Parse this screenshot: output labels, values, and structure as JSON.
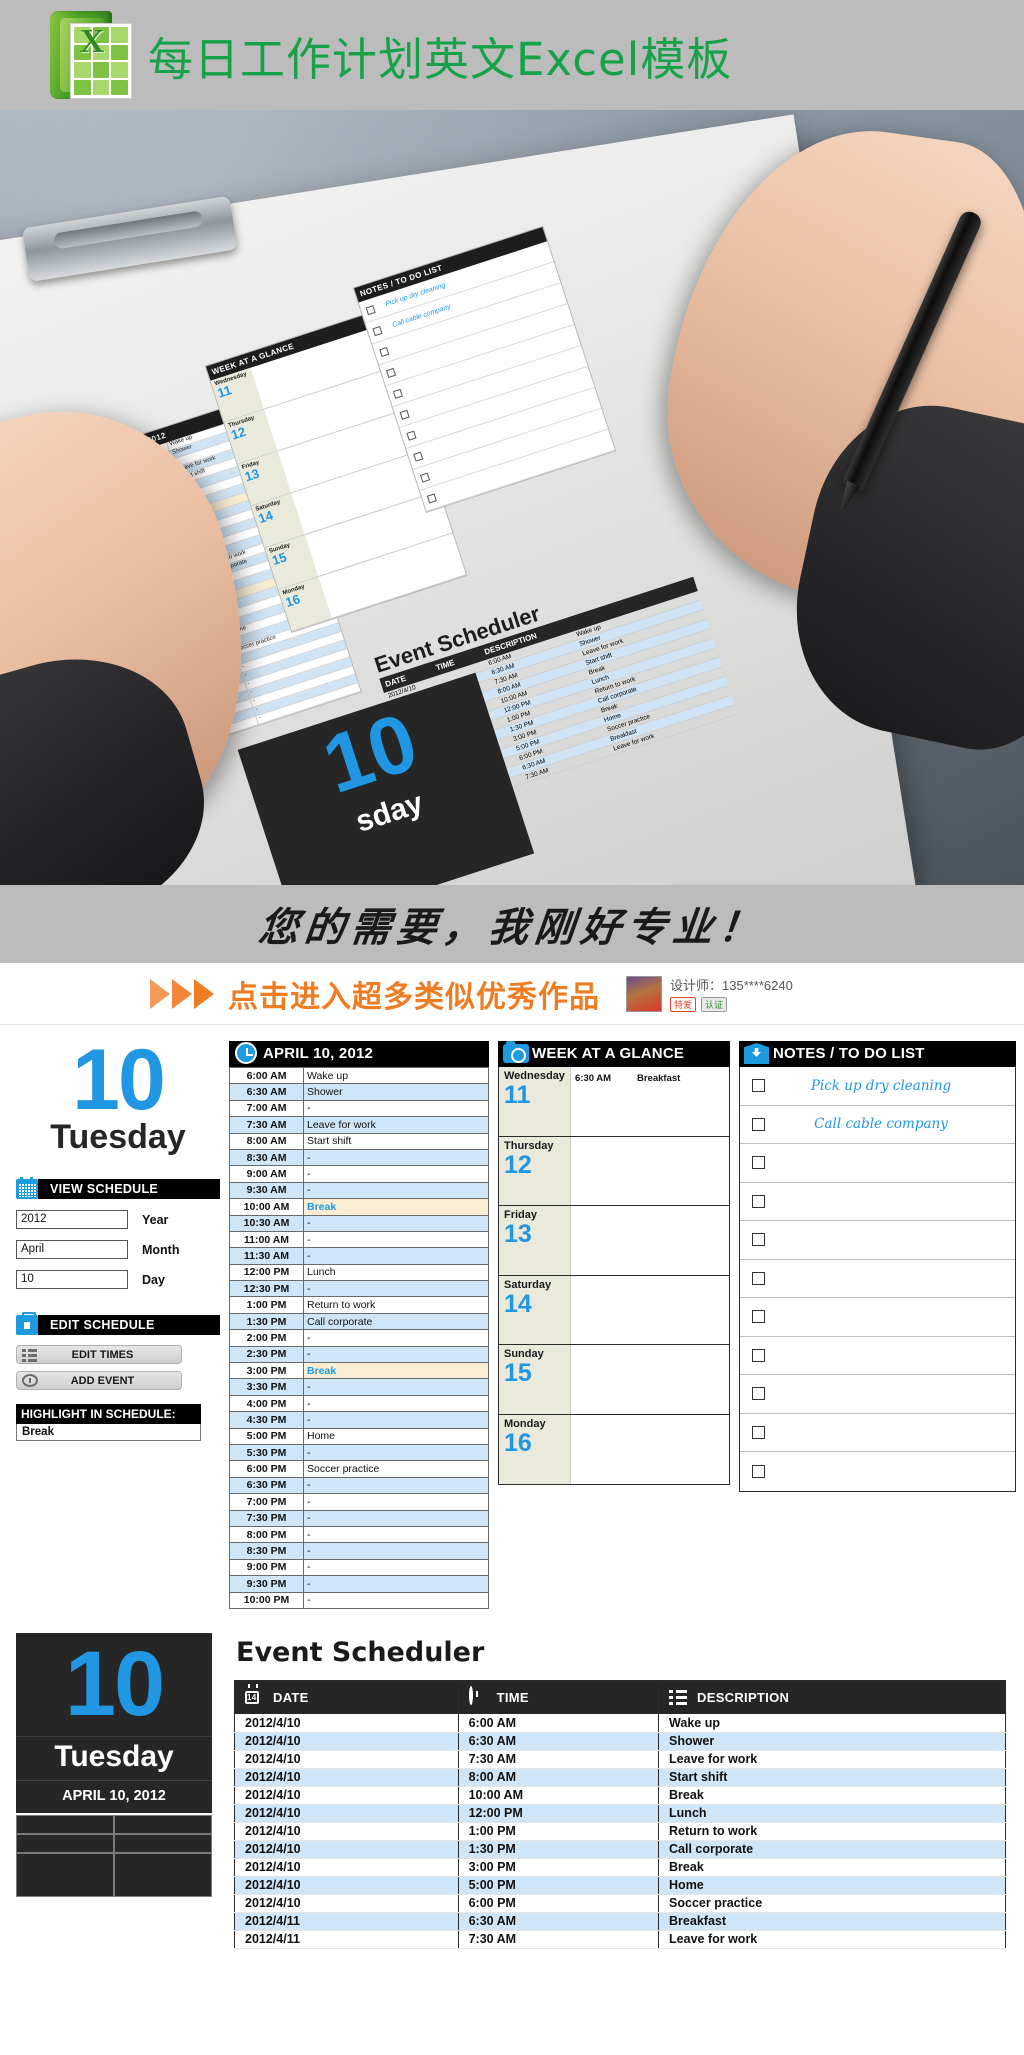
{
  "header": {
    "title": "每日工作计划英文Excel模板",
    "logo_letter": "X"
  },
  "calligraphy_banner": {
    "text": "您的需要，我刚好专业！"
  },
  "promo_banner": {
    "text": "点击进入超多类似优秀作品",
    "designer_label": "设计师：135****6240",
    "badge_red": "特爱",
    "badge_gray": "认证"
  },
  "day_card": {
    "number": "10",
    "weekday": "Tuesday",
    "date_full": "APRIL 10, 2012"
  },
  "view_schedule": {
    "title": "VIEW SCHEDULE",
    "icon": "calendar-icon",
    "fields": [
      {
        "value": "2012",
        "label": "Year"
      },
      {
        "value": "April",
        "label": "Month"
      },
      {
        "value": "10",
        "label": "Day"
      }
    ]
  },
  "edit_schedule": {
    "title": "EDIT SCHEDULE",
    "icon": "toolbox-icon",
    "buttons": [
      {
        "label": "EDIT TIMES",
        "icon": "list-icon"
      },
      {
        "label": "ADD EVENT",
        "icon": "clock-icon"
      }
    ],
    "highlight_title": "HIGHLIGHT IN SCHEDULE:",
    "highlight_value": "Break"
  },
  "schedule_panel": {
    "title": "APRIL 10, 2012",
    "icon": "clock-icon",
    "rows": [
      {
        "time": "6:00 AM",
        "desc": "Wake up",
        "alt": false,
        "hl": false
      },
      {
        "time": "6:30 AM",
        "desc": "Shower",
        "alt": true,
        "hl": false
      },
      {
        "time": "7:00 AM",
        "desc": "-",
        "alt": false,
        "hl": false
      },
      {
        "time": "7:30 AM",
        "desc": "Leave for work",
        "alt": true,
        "hl": false
      },
      {
        "time": "8:00 AM",
        "desc": "Start shift",
        "alt": false,
        "hl": false
      },
      {
        "time": "8:30 AM",
        "desc": "-",
        "alt": true,
        "hl": false
      },
      {
        "time": "9:00 AM",
        "desc": "-",
        "alt": false,
        "hl": false
      },
      {
        "time": "9:30 AM",
        "desc": "-",
        "alt": true,
        "hl": false
      },
      {
        "time": "10:00 AM",
        "desc": "Break",
        "alt": false,
        "hl": true
      },
      {
        "time": "10:30 AM",
        "desc": "-",
        "alt": true,
        "hl": false
      },
      {
        "time": "11:00 AM",
        "desc": "-",
        "alt": false,
        "hl": false
      },
      {
        "time": "11:30 AM",
        "desc": "-",
        "alt": true,
        "hl": false
      },
      {
        "time": "12:00 PM",
        "desc": "Lunch",
        "alt": false,
        "hl": false
      },
      {
        "time": "12:30 PM",
        "desc": "-",
        "alt": true,
        "hl": false
      },
      {
        "time": "1:00 PM",
        "desc": "Return to work",
        "alt": false,
        "hl": false
      },
      {
        "time": "1:30 PM",
        "desc": "Call corporate",
        "alt": true,
        "hl": false
      },
      {
        "time": "2:00 PM",
        "desc": "-",
        "alt": false,
        "hl": false
      },
      {
        "time": "2:30 PM",
        "desc": "-",
        "alt": true,
        "hl": false
      },
      {
        "time": "3:00 PM",
        "desc": "Break",
        "alt": false,
        "hl": true
      },
      {
        "time": "3:30 PM",
        "desc": "-",
        "alt": true,
        "hl": false
      },
      {
        "time": "4:00 PM",
        "desc": "-",
        "alt": false,
        "hl": false
      },
      {
        "time": "4:30 PM",
        "desc": "-",
        "alt": true,
        "hl": false
      },
      {
        "time": "5:00 PM",
        "desc": "Home",
        "alt": false,
        "hl": false
      },
      {
        "time": "5:30 PM",
        "desc": "-",
        "alt": true,
        "hl": false
      },
      {
        "time": "6:00 PM",
        "desc": "Soccer practice",
        "alt": false,
        "hl": false
      },
      {
        "time": "6:30 PM",
        "desc": "-",
        "alt": true,
        "hl": false
      },
      {
        "time": "7:00 PM",
        "desc": "-",
        "alt": false,
        "hl": false
      },
      {
        "time": "7:30 PM",
        "desc": "-",
        "alt": true,
        "hl": false
      },
      {
        "time": "8:00 PM",
        "desc": "-",
        "alt": false,
        "hl": false
      },
      {
        "time": "8:30 PM",
        "desc": "-",
        "alt": true,
        "hl": false
      },
      {
        "time": "9:00 PM",
        "desc": "-",
        "alt": false,
        "hl": false
      },
      {
        "time": "9:30 PM",
        "desc": "-",
        "alt": true,
        "hl": false
      },
      {
        "time": "10:00 PM",
        "desc": "-",
        "alt": false,
        "hl": false
      }
    ]
  },
  "week_panel": {
    "title": "WEEK AT A GLANCE",
    "icon": "camera-icon",
    "days": [
      {
        "name": "Wednesday",
        "num": "11",
        "events": [
          {
            "time": "6:30 AM",
            "desc": "Breakfast"
          }
        ]
      },
      {
        "name": "Thursday",
        "num": "12",
        "events": []
      },
      {
        "name": "Friday",
        "num": "13",
        "events": []
      },
      {
        "name": "Saturday",
        "num": "14",
        "events": []
      },
      {
        "name": "Sunday",
        "num": "15",
        "events": []
      },
      {
        "name": "Monday",
        "num": "16",
        "events": []
      }
    ]
  },
  "notes_panel": {
    "title": "NOTES / TO DO LIST",
    "icon": "inbox-icon",
    "items": [
      {
        "text": "Pick up dry cleaning"
      },
      {
        "text": "Call cable company"
      },
      {
        "text": ""
      },
      {
        "text": ""
      },
      {
        "text": ""
      },
      {
        "text": ""
      },
      {
        "text": ""
      },
      {
        "text": ""
      },
      {
        "text": ""
      },
      {
        "text": ""
      },
      {
        "text": ""
      }
    ]
  },
  "event_scheduler": {
    "title": "Event Scheduler",
    "columns": [
      {
        "label": "DATE",
        "icon": "calendar-14-icon"
      },
      {
        "label": "TIME",
        "icon": "clock-icon"
      },
      {
        "label": "DESCRIPTION",
        "icon": "bulleted-list-icon"
      }
    ],
    "rows": [
      {
        "date": "2012/4/10",
        "time": "6:00 AM",
        "desc": "Wake up",
        "alt": false
      },
      {
        "date": "2012/4/10",
        "time": "6:30 AM",
        "desc": "Shower",
        "alt": true
      },
      {
        "date": "2012/4/10",
        "time": "7:30 AM",
        "desc": "Leave for work",
        "alt": false
      },
      {
        "date": "2012/4/10",
        "time": "8:00 AM",
        "desc": "Start shift",
        "alt": true
      },
      {
        "date": "2012/4/10",
        "time": "10:00 AM",
        "desc": "Break",
        "alt": false
      },
      {
        "date": "2012/4/10",
        "time": "12:00 PM",
        "desc": "Lunch",
        "alt": true
      },
      {
        "date": "2012/4/10",
        "time": "1:00 PM",
        "desc": "Return to work",
        "alt": false
      },
      {
        "date": "2012/4/10",
        "time": "1:30 PM",
        "desc": "Call corporate",
        "alt": true
      },
      {
        "date": "2012/4/10",
        "time": "3:00 PM",
        "desc": "Break",
        "alt": false
      },
      {
        "date": "2012/4/10",
        "time": "5:00 PM",
        "desc": "Home",
        "alt": true
      },
      {
        "date": "2012/4/10",
        "time": "6:00 PM",
        "desc": "Soccer practice",
        "alt": false
      },
      {
        "date": "2012/4/11",
        "time": "6:30 AM",
        "desc": "Breakfast",
        "alt": true
      },
      {
        "date": "2012/4/11",
        "time": "7:30 AM",
        "desc": "Leave for work",
        "alt": false
      }
    ]
  },
  "colors": {
    "accent_blue": "#2196e3",
    "excel_green": "#16a249",
    "promo_orange": "#f07c22",
    "row_alt_blue": "#cfe6f8",
    "highlight_cream": "#faeed4",
    "week_beige": "#e9e9dc",
    "banner_gray": "#bcbcbc",
    "dark": "#262626"
  }
}
